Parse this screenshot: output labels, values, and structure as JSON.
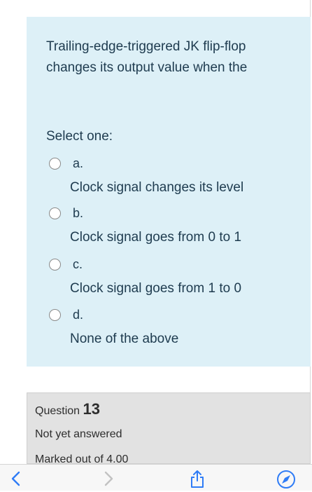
{
  "question": {
    "text_line1": "Trailing-edge-triggered JK flip-flop",
    "text_line2": "changes its output value when the",
    "prompt": "Select one:",
    "options": [
      {
        "letter": "a.",
        "text": "Clock signal changes its level"
      },
      {
        "letter": "b.",
        "text": "Clock signal goes from 0 to 1"
      },
      {
        "letter": "c.",
        "text": "Clock signal goes from 1 to 0"
      },
      {
        "letter": "d.",
        "text": "None of the above"
      }
    ]
  },
  "next_question": {
    "label": "Question",
    "number": "13",
    "status": "Not yet answered",
    "marked": "Marked out of 4.00"
  },
  "toolbar": {
    "icons": [
      "back-chevron-icon",
      "forward-chevron-icon",
      "share-icon",
      "safari-compass-icon"
    ]
  },
  "colors": {
    "question_background": "#ddf0f7",
    "info_background": "#e2e2e2",
    "ios_blue": "#2f7cf6"
  }
}
